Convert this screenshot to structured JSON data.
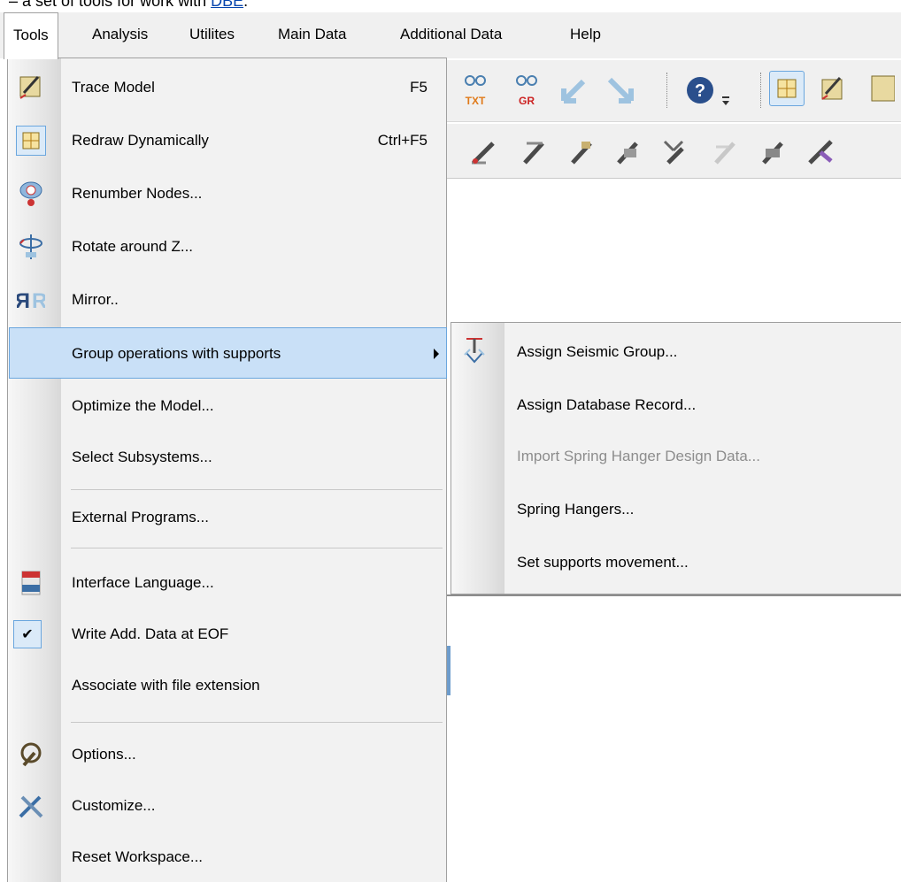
{
  "caption": {
    "prefix": "– a set of tools for work with ",
    "link": "DBE",
    "suffix": "."
  },
  "menubar": {
    "items": [
      "Tools",
      "Analysis",
      "Utilites",
      "Main Data",
      "Additional Data",
      "Help"
    ]
  },
  "tools_menu": {
    "items": [
      {
        "label": "Trace Model",
        "shortcut": "F5",
        "icon": "trace-model-icon"
      },
      {
        "label": "Redraw Dynamically",
        "shortcut": "Ctrl+F5",
        "icon": "redraw-icon"
      },
      {
        "label": "Renumber Nodes...",
        "shortcut": "",
        "icon": "renumber-nodes-icon"
      },
      {
        "label": "Rotate around Z...",
        "shortcut": "",
        "icon": "rotate-icon"
      },
      {
        "label": "Mirror..",
        "shortcut": "",
        "icon": "mirror-icon"
      },
      {
        "label": "Group operations with supports",
        "shortcut": "",
        "icon": "",
        "has_submenu": true
      },
      {
        "label": "Optimize the Model...",
        "shortcut": ""
      },
      {
        "label": "Select Subsystems...",
        "shortcut": ""
      },
      {
        "label": "External Programs...",
        "shortcut": ""
      },
      {
        "label": "Interface Language...",
        "shortcut": "",
        "icon": "language-icon"
      },
      {
        "label": "Write Add. Data at EOF",
        "shortcut": "",
        "icon": "checkmark-icon",
        "checked": true
      },
      {
        "label": "Associate with file extension",
        "shortcut": ""
      },
      {
        "label": "Options...",
        "shortcut": "",
        "icon": "options-icon"
      },
      {
        "label": "Customize...",
        "shortcut": "",
        "icon": "customize-icon"
      },
      {
        "label": "Reset Workspace...",
        "shortcut": ""
      }
    ]
  },
  "submenu": {
    "items": [
      {
        "label": "Assign Seismic Group...",
        "icon": "seismic-group-icon"
      },
      {
        "label": "Assign Database Record...",
        "enabled": true
      },
      {
        "label": "Import Spring Hanger Design Data...",
        "enabled": false
      },
      {
        "label": "Spring Hangers...",
        "enabled": true
      },
      {
        "label": "Set supports movement...",
        "enabled": true
      }
    ]
  },
  "toolbar": {
    "txt_badge": "TXT",
    "gr_badge": "GR",
    "help_glyph": "?"
  },
  "colors": {
    "highlight": "#c9e0f7",
    "highlight_border": "#6aa6de",
    "menu_bg": "#f2f2f2",
    "disabled_text": "#8d8d8d"
  }
}
